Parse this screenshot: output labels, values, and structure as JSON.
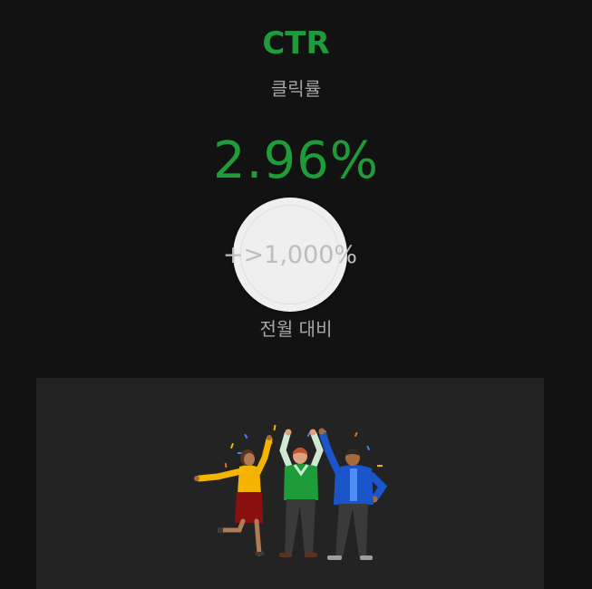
{
  "metric": {
    "title": "CTR",
    "subtitle": "클릭률",
    "value": "2.96%",
    "change_value": "+>1,000%",
    "change_label": "전월 대비"
  },
  "colors": {
    "accent": "#1e9c3a",
    "background": "#121212",
    "panel": "#232323",
    "muted_text": "#a6a6a6",
    "circle": "#efefef"
  },
  "illustration": {
    "icon": "celebrating-people-illustration"
  }
}
